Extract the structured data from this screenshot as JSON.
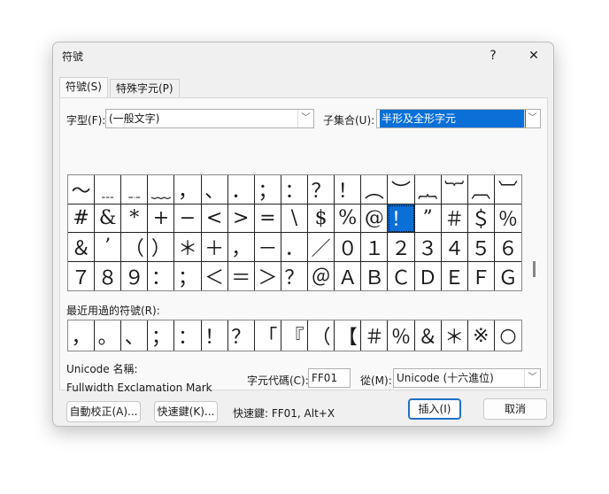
{
  "window": {
    "title": "符號",
    "help": "?",
    "close": "✕"
  },
  "tabs": [
    {
      "label": "符號(S)"
    },
    {
      "label": "特殊字元(P)"
    }
  ],
  "font": {
    "label": "字型(F):",
    "value": "(一般文字)"
  },
  "subset": {
    "label": "子集合(U):",
    "value": "半形及全形字元"
  },
  "symbols": [
    "〜",
    "﹍",
    "﹎",
    "﹏",
    "，",
    "、",
    "．",
    "；",
    "：",
    "？",
    "！",
    "︵",
    "︶",
    "︷",
    "︸",
    "︹",
    "︺",
    "#",
    "&",
    "*",
    "+",
    "−",
    "<",
    ">",
    "=",
    "\\",
    "$",
    "%",
    "@",
    "！",
    "”",
    "＃",
    "＄",
    "％",
    "＆",
    "’",
    "（",
    "）",
    "＊",
    "＋",
    "，",
    "－",
    "．",
    "／",
    "０",
    "１",
    "２",
    "３",
    "４",
    "５",
    "６",
    "７",
    "８",
    "９",
    "：",
    "；",
    "＜",
    "＝",
    "＞",
    "？",
    "＠",
    "Ａ",
    "Ｂ",
    "Ｃ",
    "Ｄ",
    "Ｅ",
    "Ｆ",
    "Ｇ"
  ],
  "selected_index": 29,
  "recent": {
    "label": "最近用過的符號(R):",
    "symbols": [
      "，",
      "。",
      "、",
      "；",
      "：",
      "！",
      "？",
      "「",
      "『",
      "（",
      "【",
      "＃",
      "％",
      "＆",
      "＊",
      "※",
      "○"
    ]
  },
  "unicode_name": {
    "label": "Unicode 名稱:",
    "value": "Fullwidth Exclamation Mark"
  },
  "char_code": {
    "label": "字元代碼(C):",
    "value": "FF01"
  },
  "from": {
    "label": "從(M):",
    "value": "Unicode (十六進位)"
  },
  "buttons": {
    "autocorrect": "自動校正(A)...",
    "shortcut": "快速鍵(K)...",
    "insert": "插入(I)",
    "cancel": "取消"
  },
  "shortcut_text": "快速鍵: FF01, Alt+X",
  "colors": {
    "selection": "#0a6fd6",
    "accent": "#1f6fc4"
  }
}
